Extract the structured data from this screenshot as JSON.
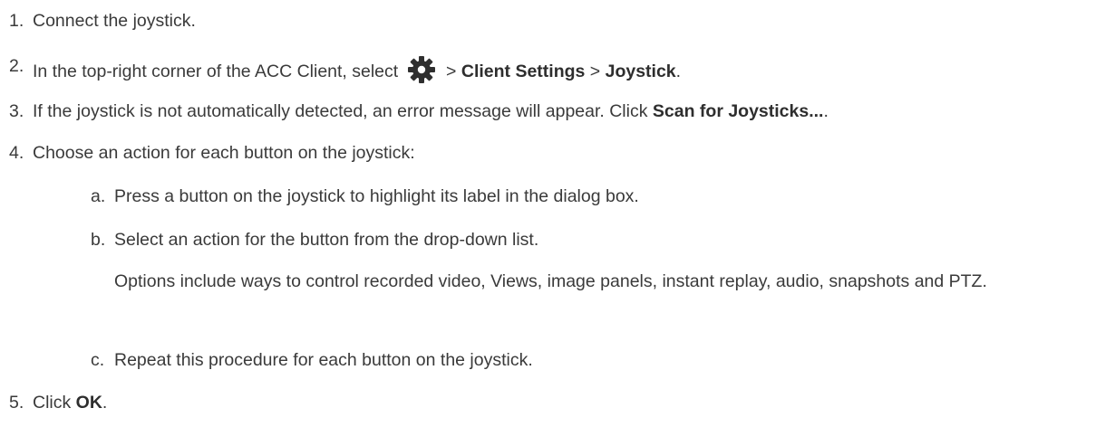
{
  "steps": [
    {
      "num": "1.",
      "text": "Connect the joystick."
    },
    {
      "num": "2.",
      "pre": "In the top-right corner of the ACC Client, select",
      "icon": "gear-icon",
      "sep1": " > ",
      "b1": "Client Settings",
      "sep2": " > ",
      "b2": "Joystick",
      "post": "."
    },
    {
      "num": "3.",
      "pre": "If the joystick is not automatically detected, an error message will appear. Click ",
      "b1": "Scan for Joysticks...",
      "post": "."
    },
    {
      "num": "4.",
      "text": "Choose an action for each button on the joystick:"
    },
    {
      "num": "5.",
      "pre": "Click ",
      "b1": "OK",
      "post": "."
    }
  ],
  "substeps": [
    {
      "letter": "a.",
      "text": "Press a button on the joystick to highlight its label in the dialog box."
    },
    {
      "letter": "b.",
      "text": "Select an action for the button from the drop-down list."
    },
    {
      "letter": "c.",
      "text": "Repeat this procedure for each button on the joystick."
    }
  ],
  "note": "Options include ways to control recorded video, Views, image panels, instant replay, audio, snapshots and PTZ."
}
